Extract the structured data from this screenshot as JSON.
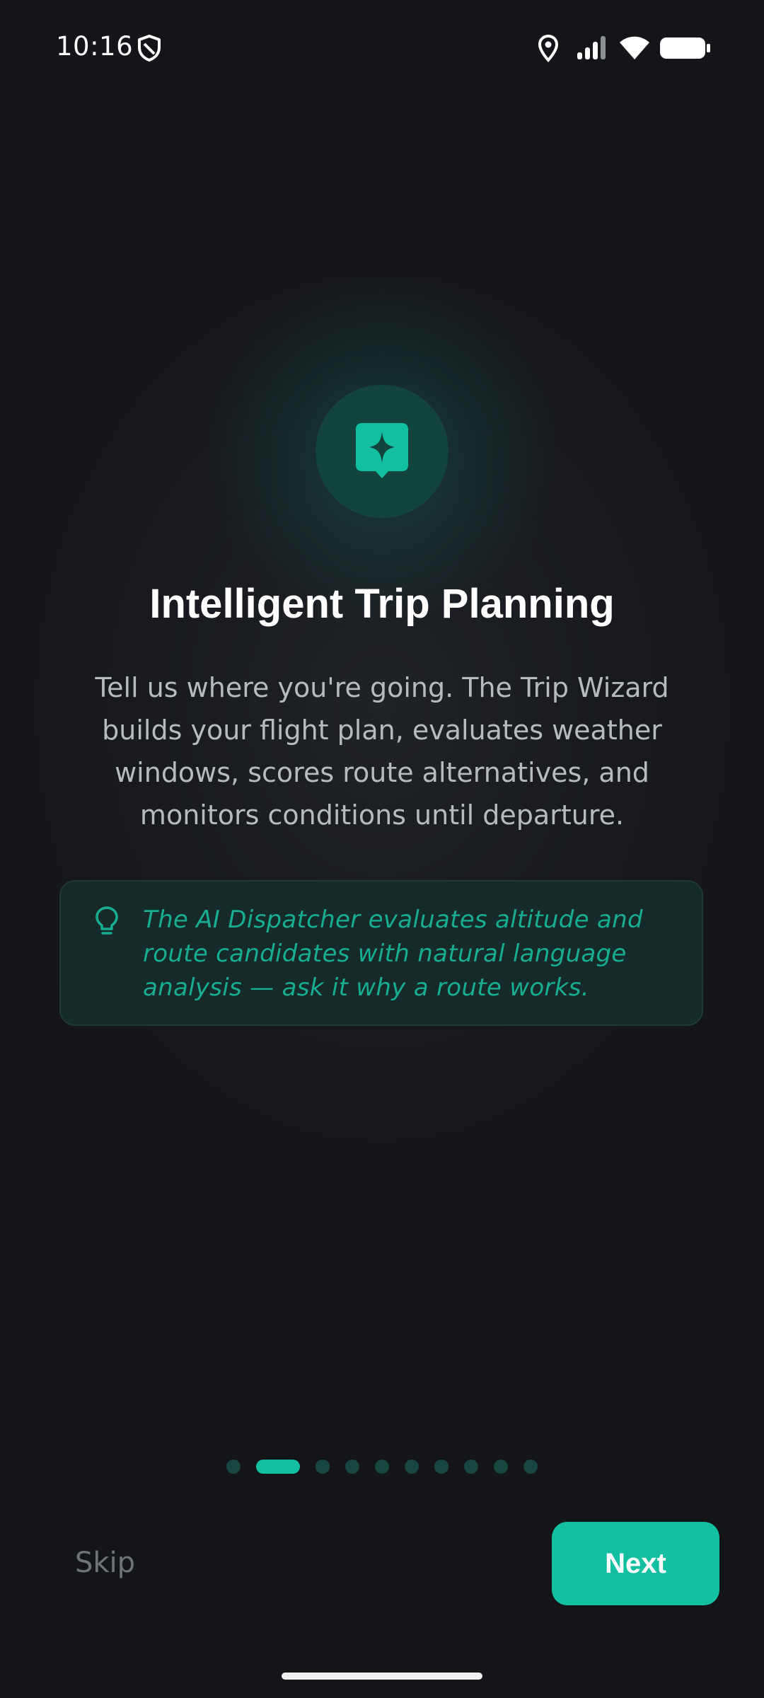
{
  "status_bar": {
    "time": "10:16",
    "icons": [
      "shield-icon",
      "location-icon",
      "signal-icon",
      "wifi-icon",
      "battery-icon"
    ]
  },
  "hero": {
    "icon": "sparkle-chat-icon",
    "accent_color": "#12bfa1"
  },
  "title": "Intelligent Trip Planning",
  "description": "Tell us where you're going. The Trip Wizard builds your flight plan, evaluates weather windows, scores route alternatives, and monitors conditions until departure.",
  "tip": {
    "icon": "lightbulb-icon",
    "text": "The AI Dispatcher evaluates altitude and route candidates with natural language analysis — ask it why a route works."
  },
  "pagination": {
    "total": 10,
    "current": 2
  },
  "actions": {
    "skip_label": "Skip",
    "next_label": "Next"
  }
}
